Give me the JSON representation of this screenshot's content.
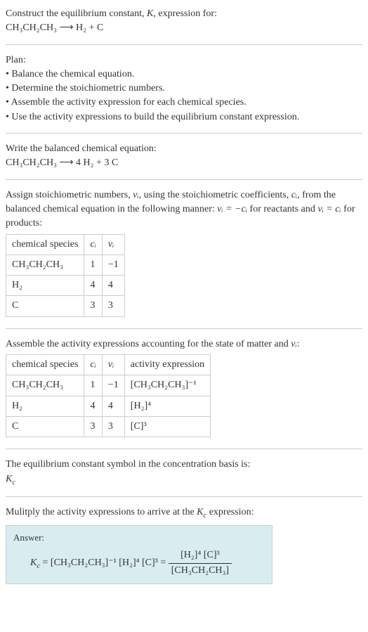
{
  "intro": {
    "line1": "Construct the equilibrium constant, K, expression for:",
    "eq": "CH₃CH₂CH₃ ⟶ H₂ + C"
  },
  "plan": {
    "header": "Plan:",
    "b1": "• Balance the chemical equation.",
    "b2": "• Determine the stoichiometric numbers.",
    "b3": "• Assemble the activity expression for each chemical species.",
    "b4": "• Use the activity expressions to build the equilibrium constant expression."
  },
  "balanced": {
    "header": "Write the balanced chemical equation:",
    "eq": "CH₃CH₂CH₃ ⟶ 4 H₂ + 3 C"
  },
  "stoich": {
    "intro_a": "Assign stoichiometric numbers, ",
    "intro_b": ", using the stoichiometric coefficients, ",
    "intro_c": ", from the balanced chemical equation in the following manner: ",
    "intro_d": " for reactants and ",
    "intro_e": " for products:",
    "nu": "νᵢ",
    "ci": "cᵢ",
    "rel_react": "νᵢ = −cᵢ",
    "rel_prod": "νᵢ = cᵢ",
    "h_species": "chemical species",
    "h_c": "cᵢ",
    "h_nu": "νᵢ",
    "r1": {
      "sp": "CH₃CH₂CH₃",
      "c": "1",
      "nu": "−1"
    },
    "r2": {
      "sp": "H₂",
      "c": "4",
      "nu": "4"
    },
    "r3": {
      "sp": "C",
      "c": "3",
      "nu": "3"
    }
  },
  "activity": {
    "intro_a": "Assemble the activity expressions accounting for the state of matter and ",
    "intro_b": ":",
    "h_species": "chemical species",
    "h_c": "cᵢ",
    "h_nu": "νᵢ",
    "h_act": "activity expression",
    "r1": {
      "sp": "CH₃CH₂CH₃",
      "c": "1",
      "nu": "−1",
      "act": "[CH₃CH₂CH₃]⁻¹"
    },
    "r2": {
      "sp": "H₂",
      "c": "4",
      "nu": "4",
      "act": "[H₂]⁴"
    },
    "r3": {
      "sp": "C",
      "c": "3",
      "nu": "3",
      "act": "[C]³"
    }
  },
  "ksym": {
    "line": "The equilibrium constant symbol in the concentration basis is:",
    "sym": "K_c"
  },
  "final": {
    "intro_a": "Mulitply the activity expressions to arrive at the ",
    "intro_b": " expression:",
    "kc": "K_c",
    "answer_label": "Answer:",
    "lhs": "K_c = [CH₃CH₂CH₃]⁻¹ [H₂]⁴ [C]³ = ",
    "num": "[H₂]⁴ [C]³",
    "den": "[CH₃CH₂CH₃]"
  }
}
